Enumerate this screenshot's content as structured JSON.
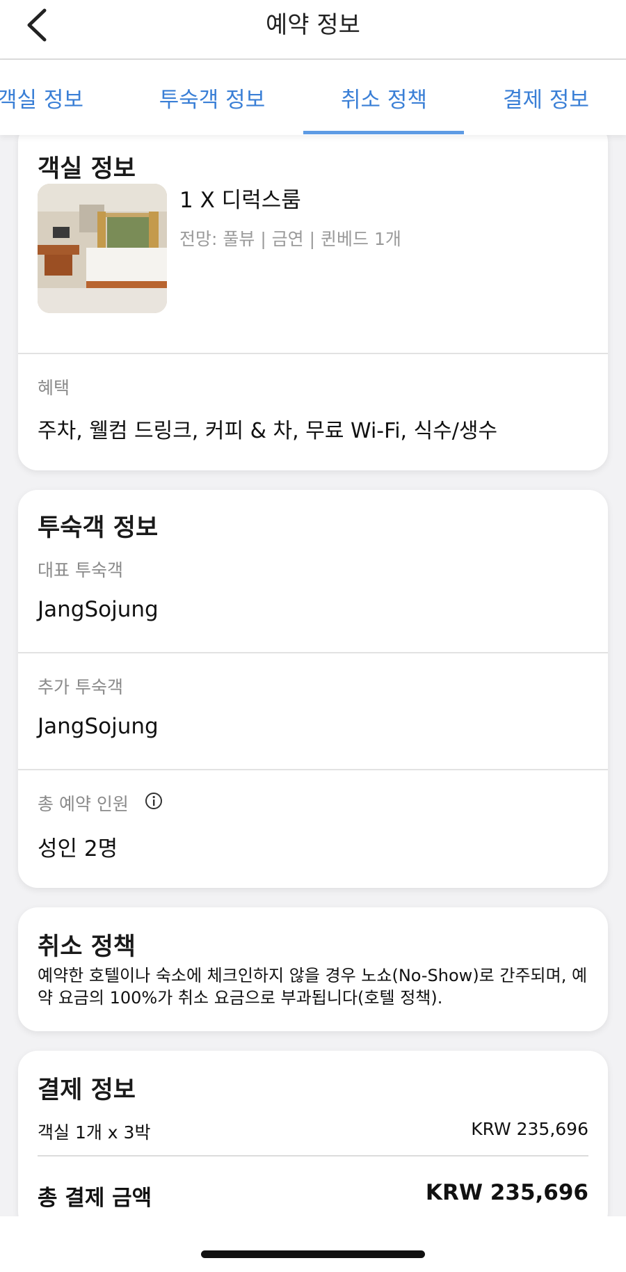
{
  "header": {
    "title": "예약 정보"
  },
  "tabs": [
    {
      "label": "객실 정보"
    },
    {
      "label": "투숙객 정보"
    },
    {
      "label": "취소 정책"
    },
    {
      "label": "결제 정보"
    }
  ],
  "active_tab": "취소 정책",
  "room": {
    "title": "객실 정보",
    "name": "1 X 디럭스룸",
    "details": "전망: 풀뷰 | 금연 | 퀸베드 1개",
    "benefits_label": "혜택",
    "benefits": "주차, 웰컴 드링크, 커피 & 차, 무료 Wi-Fi, 식수/생수"
  },
  "guest": {
    "title": "투숙객 정보",
    "main_label": "대표 투숙객",
    "main_value": "JangSojung",
    "extra_label": "추가 투숙객",
    "extra_value": "JangSojung",
    "total_label": "총 예약 인원",
    "total_value": "성인 2명"
  },
  "cancel": {
    "title": "취소 정책",
    "text": "예약한 호텔이나 숙소에 체크인하지 않을 경우 노쇼(No-Show)로 간주되며, 예약 요금의 100%가 취소 요금으로 부과됩니다(호텔 정책)."
  },
  "payment": {
    "title": "결제 정보",
    "room_label": "객실 1개 x 3박",
    "room_amount": "KRW 235,696",
    "total_label": "총 결제 금액",
    "total_amount": "KRW 235,696"
  },
  "icons": {
    "back": "chevron-left-icon",
    "info": "info-circle-icon"
  },
  "colors": {
    "accent": "#3a7fd6",
    "indicator": "#5e9be4"
  }
}
